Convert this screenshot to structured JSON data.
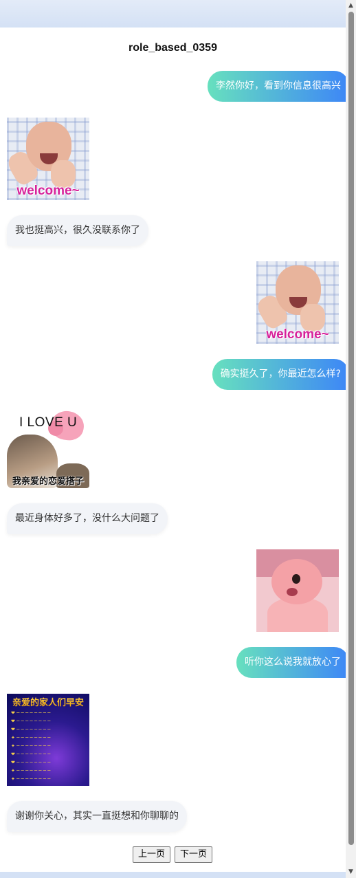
{
  "page": {
    "title": "role_based_0359"
  },
  "messages": [
    {
      "side": "right",
      "type": "text",
      "text": "李然你好，看到你信息很高兴"
    },
    {
      "side": "left",
      "type": "sticker",
      "sticker": "baby-welcome-sticker",
      "caption": "welcome~"
    },
    {
      "side": "left",
      "type": "text",
      "text": "我也挺高兴，很久没联系你了"
    },
    {
      "side": "right",
      "type": "sticker",
      "sticker": "baby-welcome-sticker",
      "caption": "welcome~"
    },
    {
      "side": "right",
      "type": "text",
      "text": "确实挺久了，你最近怎么样?"
    },
    {
      "side": "left",
      "type": "sticker",
      "sticker": "cat-love-sticker",
      "heading": "I LOVE U",
      "caption": "我亲爱的恋爱搭子"
    },
    {
      "side": "left",
      "type": "text",
      "text": "最近身体好多了，没什么大问题了"
    },
    {
      "side": "right",
      "type": "sticker",
      "sticker": "pink-beaver-sticker"
    },
    {
      "side": "right",
      "type": "text",
      "text": "听你这么说我就放心了"
    },
    {
      "side": "left",
      "type": "sticker",
      "sticker": "good-morning-card-sticker",
      "caption": "亲爱的家人们早安"
    },
    {
      "side": "left",
      "type": "text",
      "text": "谢谢你关心，其实一直挺想和你聊聊的"
    }
  ],
  "pagination": {
    "prev_label": "上一页",
    "next_label": "下一页"
  },
  "colors": {
    "accent_gradient_start": "#67e0be",
    "accent_gradient_end": "#3d86f7",
    "incoming_bubble": "#f2f4f8",
    "header_band": "#dce6f6"
  }
}
